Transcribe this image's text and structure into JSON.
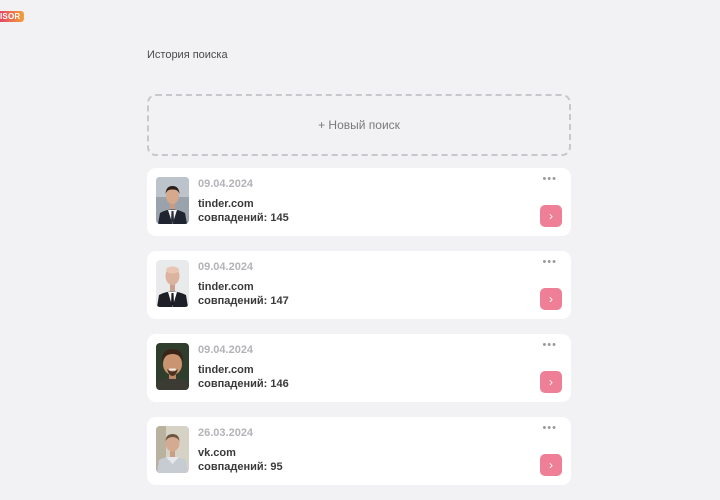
{
  "logo": {
    "text": "ISOR"
  },
  "history": {
    "title": "История поиска",
    "new_search_label": "+ Новый поиск",
    "menu_icon": "more-horizontal-icon",
    "open_icon": "chevron-right-icon",
    "open_glyph": "›",
    "accent_color": "#ef7f96",
    "items": [
      {
        "date": "09.04.2024",
        "site": "tinder.com",
        "matches": "совпадений: 145"
      },
      {
        "date": "09.04.2024",
        "site": "tinder.com",
        "matches": "совпадений: 147"
      },
      {
        "date": "09.04.2024",
        "site": "tinder.com",
        "matches": "совпадений: 146"
      },
      {
        "date": "26.03.2024",
        "site": "vk.com",
        "matches": "совпадений: 95"
      }
    ]
  }
}
